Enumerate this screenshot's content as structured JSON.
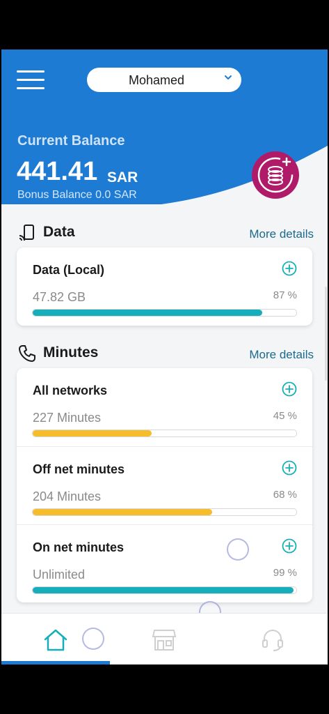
{
  "header": {
    "account_name": "Mohamed",
    "menu_icon": "hamburger-menu-icon",
    "dropdown_icon": "chevron-down-icon"
  },
  "balance": {
    "label": "Current Balance",
    "amount": "441.41",
    "currency": "SAR",
    "bonus": "Bonus Balance 0.0 SAR",
    "topup_icon": "coins-plus-icon"
  },
  "data_section": {
    "title": "Data",
    "more": "More details",
    "icon": "signal-device-icon",
    "items": [
      {
        "title": "Data (Local)",
        "amount": "47.82 GB",
        "percent": "87 %",
        "fill": 0.87,
        "color": "#17aebc"
      }
    ]
  },
  "minutes_section": {
    "title": "Minutes",
    "more": "More details",
    "icon": "phone-icon",
    "items": [
      {
        "title": "All networks",
        "amount": "227 Minutes",
        "percent": "45 %",
        "fill": 0.45,
        "color": "#f5bd2c"
      },
      {
        "title": "Off net minutes",
        "amount": "204 Minutes",
        "percent": "68 %",
        "fill": 0.68,
        "color": "#f5bd2c"
      },
      {
        "title": "On net minutes",
        "amount": "Unlimited",
        "percent": "99 %",
        "fill": 0.99,
        "color": "#17aebc"
      }
    ]
  },
  "tabs": [
    {
      "name": "home",
      "icon": "home-icon",
      "active": true
    },
    {
      "name": "store",
      "icon": "store-icon",
      "active": false
    },
    {
      "name": "support",
      "icon": "headset-icon",
      "active": false
    }
  ],
  "colors": {
    "brand_blue": "#1e7bd4",
    "accent_magenta": "#b01b69",
    "teal": "#17aebc",
    "yellow": "#f5bd2c"
  }
}
